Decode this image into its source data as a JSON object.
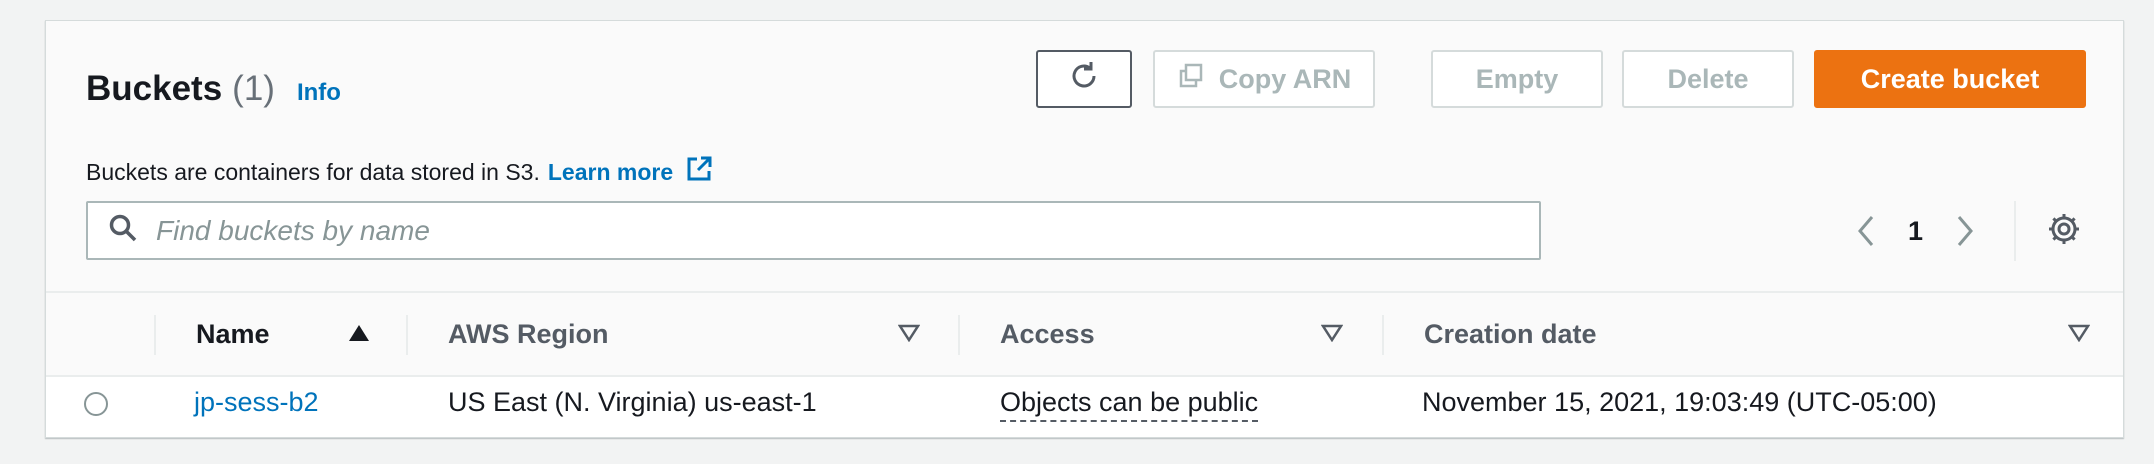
{
  "header": {
    "title": "Buckets",
    "count": "(1)",
    "info": "Info",
    "description": "Buckets are containers for data stored in S3.",
    "learn_more": "Learn more"
  },
  "toolbar": {
    "copy_arn": "Copy ARN",
    "empty": "Empty",
    "delete": "Delete",
    "create_bucket": "Create bucket"
  },
  "search": {
    "placeholder": "Find buckets by name",
    "value": ""
  },
  "pagination": {
    "current_page": "1"
  },
  "table": {
    "columns": [
      "Name",
      "AWS Region",
      "Access",
      "Creation date"
    ],
    "rows": [
      {
        "name": "jp-sess-b2",
        "region": "US East (N. Virginia) us-east-1",
        "access": "Objects can be public",
        "created": "November 15, 2021, 19:03:49 (UTC-05:00)"
      }
    ]
  },
  "colors": {
    "accent": "#ec7211",
    "link": "#0073bb",
    "disabled_text": "#aab7b8"
  }
}
